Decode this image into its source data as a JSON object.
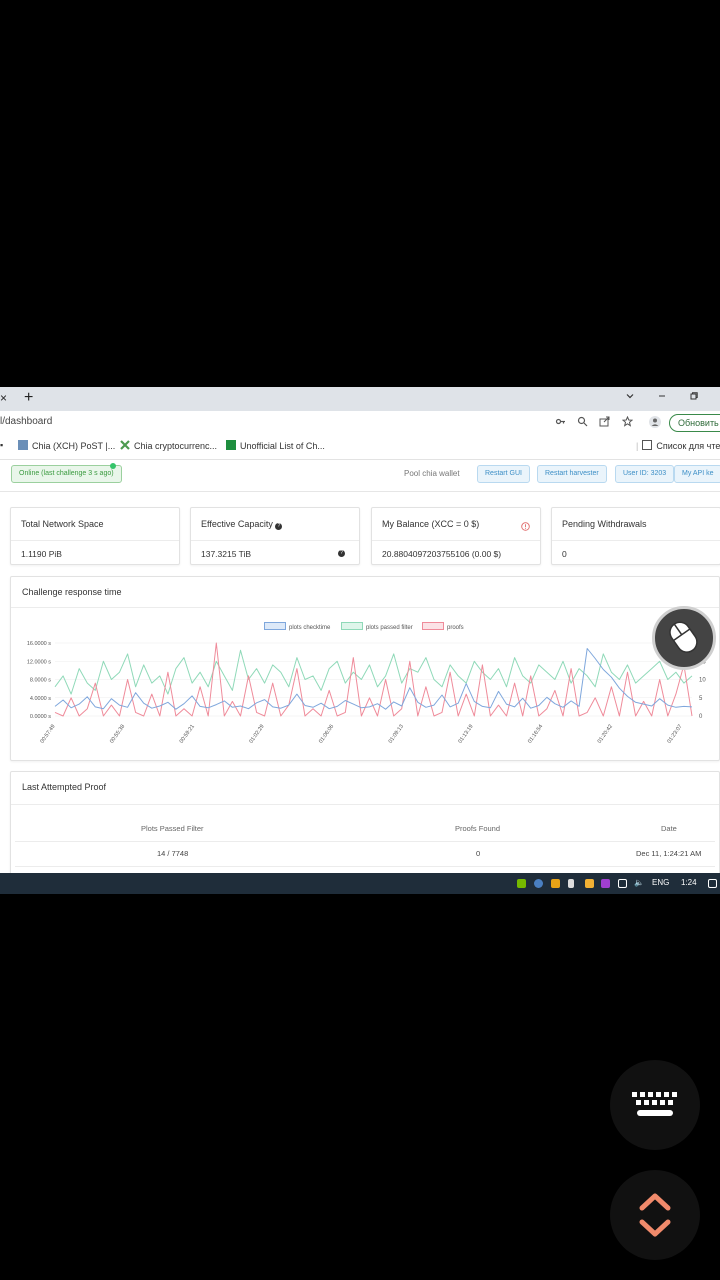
{
  "browser": {
    "tab_close": "×",
    "new_tab": "+",
    "url": "l/dashboard",
    "update_button": "Обновить",
    "bookmarks": [
      {
        "label": "Chia (XCH) PoST |...",
        "color": "#6b8fb8"
      },
      {
        "label": "Chia cryptocurrenc...",
        "color": "#4c9a4f"
      },
      {
        "label": "Unofficial List of Ch...",
        "color": "#1e8e3e"
      },
      {
        "label": "Список для чте",
        "color": "#555555"
      }
    ]
  },
  "dashboard": {
    "status_badge": "Online (last challenge 3 s ago)",
    "pool_wallet_label": "Pool chia wallet",
    "buttons": [
      "Restart GUI",
      "Restart harvester",
      "User ID: 3203",
      "My API ke"
    ],
    "stats": [
      {
        "title": "Total Network Space",
        "value": "1.1190 PiB"
      },
      {
        "title": "Effective Capacity",
        "value": "137.3215 TiB"
      },
      {
        "title": "My Balance (XCC = 0 $)",
        "value": "20.8804097203755106 (0.00 $)"
      },
      {
        "title": "Pending Withdrawals",
        "value": "0"
      }
    ],
    "chart_title": "Challenge response time",
    "last_proof_title": "Last Attempted Proof",
    "table": {
      "headers": [
        "Plots Passed Filter",
        "Proofs Found",
        "Date"
      ],
      "row": [
        "14 / 7748",
        "0",
        "Dec 11, 1:24:21 AM"
      ]
    }
  },
  "chart_data": {
    "type": "line",
    "title": "Challenge response time",
    "legend": [
      "plots checktime",
      "plots passed filter",
      "proofs"
    ],
    "colors": {
      "plots checktime": "#7fa7dc",
      "plots passed filter": "#8fd9b8",
      "proofs": "#ef8b9a"
    },
    "y_left_ticks": [
      "0.0000 s",
      "4.0000 s",
      "8.0000 s",
      "12.0000 s",
      "16.0000 s"
    ],
    "y_left_range": [
      0,
      16
    ],
    "y_right_ticks": [
      "0",
      "5",
      "10",
      "15",
      "20"
    ],
    "y_right_range": [
      0,
      20
    ],
    "x_ticks": [
      "00:57:49",
      "00:55:38",
      "00:59:21",
      "01:02:29",
      "01:06:06",
      "01:09:13",
      "01:13:19",
      "01:16:54",
      "01:20:42",
      "01:23:07"
    ],
    "series": [
      {
        "name": "plots checktime",
        "axis": "left",
        "values": [
          2.1,
          3.5,
          1.8,
          2.6,
          4.2,
          2.0,
          1.6,
          3.8,
          2.4,
          1.9,
          5.1,
          2.8,
          1.7,
          2.2,
          3.0,
          1.5,
          2.7,
          4.4,
          2.1,
          1.8,
          2.5,
          3.3,
          1.9,
          2.2,
          1.6,
          2.9,
          3.6,
          2.0,
          1.7,
          2.4,
          4.8,
          2.3,
          1.9,
          2.8,
          1.6,
          2.1,
          3.4,
          2.6,
          1.8,
          2.0,
          2.7,
          1.5,
          3.1,
          2.2,
          6.2,
          3.0,
          1.9,
          2.4,
          4.6,
          2.0,
          2.8,
          7.1,
          3.2,
          2.1,
          1.8,
          5.4,
          2.6,
          2.0,
          3.9,
          1.7,
          2.3,
          4.1,
          2.7,
          1.9,
          3.3,
          2.1,
          14.8,
          12.6,
          10.2,
          8.5,
          6.1,
          4.3,
          3.0,
          2.6,
          2.2,
          3.8,
          2.4,
          1.9,
          2.1,
          2.0
        ]
      },
      {
        "name": "plots passed filter",
        "axis": "right",
        "values": [
          8,
          11,
          6,
          13,
          9,
          7,
          15,
          10,
          12,
          17,
          8,
          14,
          9,
          11,
          6,
          13,
          16,
          9,
          12,
          8,
          15,
          11,
          7,
          18,
          10,
          13,
          9,
          14,
          12,
          8,
          16,
          10,
          11,
          7,
          13,
          15,
          9,
          12,
          10,
          14,
          8,
          11,
          17,
          9,
          13,
          12,
          16,
          10,
          8,
          14,
          11,
          9,
          15,
          12,
          10,
          13,
          8,
          16,
          11,
          9,
          14,
          12,
          10,
          15,
          9,
          13,
          11,
          8,
          17,
          12,
          10,
          14,
          9,
          11,
          13,
          15,
          10,
          12,
          9,
          11
        ]
      },
      {
        "name": "proofs",
        "axis": "right",
        "values": [
          1,
          0,
          5,
          0,
          2,
          9,
          0,
          3,
          0,
          10,
          1,
          0,
          6,
          0,
          12,
          0,
          2,
          0,
          8,
          0,
          20,
          0,
          4,
          0,
          11,
          1,
          0,
          9,
          0,
          3,
          13,
          0,
          2,
          0,
          7,
          0,
          1,
          16,
          0,
          5,
          0,
          10,
          0,
          2,
          15,
          0,
          8,
          0,
          1,
          12,
          0,
          6,
          0,
          14,
          0,
          3,
          0,
          9,
          0,
          11,
          0,
          2,
          7,
          0,
          13,
          0,
          1,
          5,
          0,
          8,
          0,
          12,
          0,
          4,
          0,
          10,
          0,
          6,
          14,
          0
        ]
      }
    ]
  },
  "taskbar": {
    "lang": "ENG",
    "time": "1:24"
  }
}
